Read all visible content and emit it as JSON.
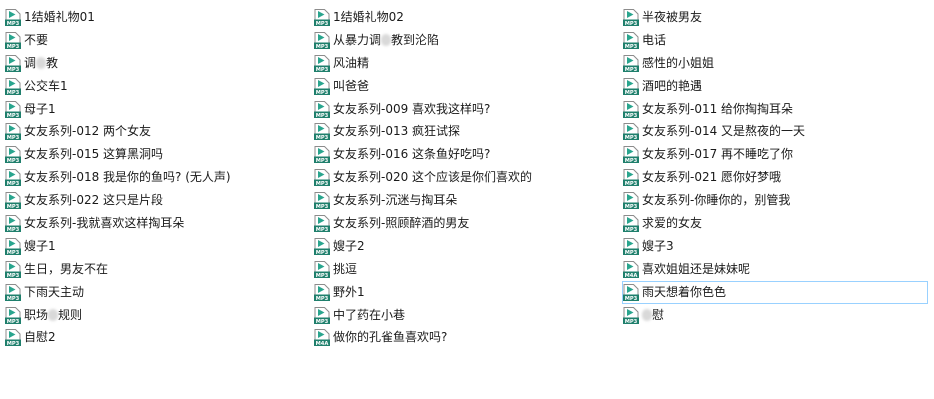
{
  "file_icon": "audio-file-icon",
  "colors": {
    "icon_teal": "#2aa58e",
    "icon_teal_dark": "#1f7f6c",
    "selection_border": "#99d1ff"
  },
  "columns": [
    {
      "files": [
        {
          "name": "1结婚礼物01",
          "ext": "MP3"
        },
        {
          "name": "不要",
          "ext": "MP3"
        },
        {
          "name": "调教",
          "ext": "MP3"
        },
        {
          "name": "公交车1",
          "ext": "MP3"
        },
        {
          "name": "母子1",
          "ext": "MP3"
        },
        {
          "name": "女友系列-012 两个女友",
          "ext": "MP3"
        },
        {
          "name": "女友系列-015 这算黑洞吗",
          "ext": "MP3"
        },
        {
          "name": "女友系列-018 我是你的鱼吗? (无人声)",
          "ext": "MP3"
        },
        {
          "name": "女友系列-022 这只是片段",
          "ext": "MP3"
        },
        {
          "name": "女友系列-我就喜欢这样掏耳朵",
          "ext": "MP3"
        },
        {
          "name": "嫂子1",
          "ext": "MP3"
        },
        {
          "name": "生日，男友不在",
          "ext": "MP3"
        },
        {
          "name": "下雨天主动",
          "ext": "MP3"
        },
        {
          "name": "职场规则",
          "ext": "MP3"
        },
        {
          "name": "自慰2",
          "ext": "MP3"
        }
      ]
    },
    {
      "files": [
        {
          "name": "1结婚礼物02",
          "ext": "MP3"
        },
        {
          "name": "从暴力调教到沦陷",
          "ext": "MP3"
        },
        {
          "name": "风油精",
          "ext": "MP3"
        },
        {
          "name": "叫爸爸",
          "ext": "MP3"
        },
        {
          "name": "女友系列-009 喜欢我这样吗?",
          "ext": "MP3"
        },
        {
          "name": "女友系列-013 疯狂试探",
          "ext": "MP3"
        },
        {
          "name": "女友系列-016 这条鱼好吃吗?",
          "ext": "MP3"
        },
        {
          "name": "女友系列-020 这个应该是你们喜欢的",
          "ext": "MP3"
        },
        {
          "name": "女友系列-沉迷与掏耳朵",
          "ext": "MP3"
        },
        {
          "name": "女友系列-照顾醉酒的男友",
          "ext": "MP3"
        },
        {
          "name": "嫂子2",
          "ext": "MP3"
        },
        {
          "name": "挑逗",
          "ext": "MP3"
        },
        {
          "name": "野外1",
          "ext": "MP3"
        },
        {
          "name": "中了药在小巷",
          "ext": "MP3"
        },
        {
          "name": "做你的孔雀鱼喜欢吗?",
          "ext": "M4A"
        }
      ]
    },
    {
      "files": [
        {
          "name": "半夜被男友",
          "ext": "MP3"
        },
        {
          "name": "电话",
          "ext": "MP3"
        },
        {
          "name": "感性的小姐姐",
          "ext": "MP3"
        },
        {
          "name": "酒吧的艳遇",
          "ext": "MP3"
        },
        {
          "name": "女友系列-011 给你掏掏耳朵",
          "ext": "MP3"
        },
        {
          "name": "女友系列-014 又是熬夜的一天",
          "ext": "MP3"
        },
        {
          "name": "女友系列-017 再不睡吃了你",
          "ext": "MP3"
        },
        {
          "name": "女友系列-021 愿你好梦哦",
          "ext": "MP3"
        },
        {
          "name": "女友系列-你睡你的，别管我",
          "ext": "MP3"
        },
        {
          "name": "求爱的女友",
          "ext": "MP3"
        },
        {
          "name": "嫂子3",
          "ext": "MP3"
        },
        {
          "name": "喜欢姐姐还是妹妹呢",
          "ext": "M4A"
        },
        {
          "name": "雨天想着你色色",
          "ext": "MP3"
        },
        {
          "name": "慰",
          "ext": "MP3"
        }
      ]
    }
  ]
}
